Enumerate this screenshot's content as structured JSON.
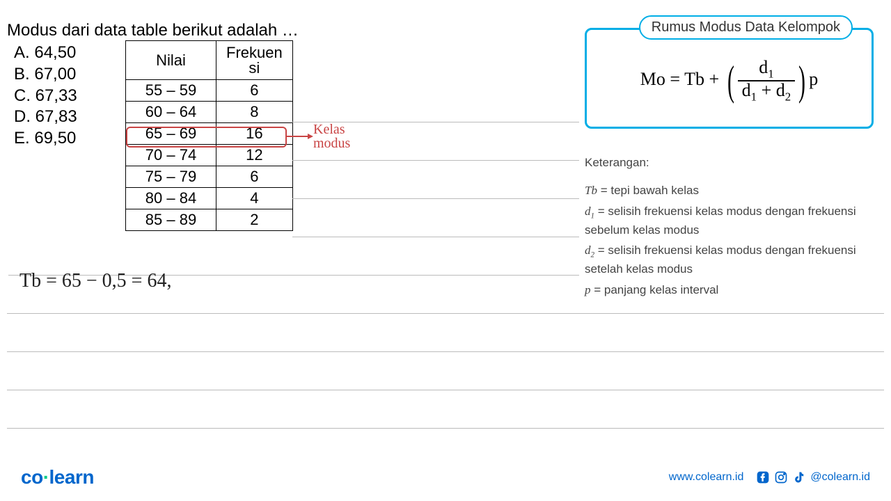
{
  "question": "Modus dari data table berikut adalah …",
  "answers": {
    "a": "A. 64,50",
    "b": "B. 67,00",
    "c": "C. 67,33",
    "d": "D. 67,83",
    "e": "E. 69,50"
  },
  "table": {
    "header_nilai": "Nilai",
    "header_frekuensi_line1": "Frekuen",
    "header_frekuensi_line2": "si",
    "rows": [
      {
        "nilai": "55 – 59",
        "freq": "6"
      },
      {
        "nilai": "60 – 64",
        "freq": "8"
      },
      {
        "nilai": "65 – 69",
        "freq": "16"
      },
      {
        "nilai": "70 – 74",
        "freq": "12"
      },
      {
        "nilai": "75 – 79",
        "freq": "6"
      },
      {
        "nilai": "80 – 84",
        "freq": "4"
      },
      {
        "nilai": "85 – 89",
        "freq": "2"
      }
    ]
  },
  "modal_annotation_line1": "Kelas",
  "modal_annotation_line2": "modus",
  "formula": {
    "title": "Rumus Modus Data Kelompok",
    "lhs": "Mo = Tb +",
    "numerator": "d",
    "numerator_sub": "1",
    "denom_part1": "d",
    "denom_sub1": "1",
    "denom_plus": "+ d",
    "denom_sub2": "2",
    "suffix": "p"
  },
  "keterangan": {
    "title": "Keterangan:",
    "tb": "Tb",
    "tb_desc": " = tepi bawah kelas",
    "d1": "d",
    "d1_sub": "1",
    "d1_desc": " = selisih frekuensi kelas modus dengan frekuensi sebelum kelas modus",
    "d2": "d",
    "d2_sub": "2",
    "d2_desc": " = selisih frekuensi kelas modus dengan frekuensi setelah kelas modus",
    "p": "p",
    "p_desc": " = panjang kelas interval"
  },
  "handwritten": "Tb = 65 − 0,5 = 64,",
  "footer": {
    "logo_part1": "co",
    "logo_dot": " ",
    "logo_part2": "learn",
    "website": "www.colearn.id",
    "handle": "@colearn.id"
  },
  "chart_data": {
    "type": "table",
    "title": "Modus dari data table berikut adalah …",
    "columns": [
      "Nilai",
      "Frekuensi"
    ],
    "rows": [
      [
        "55 – 59",
        6
      ],
      [
        "60 – 64",
        8
      ],
      [
        "65 – 69",
        16
      ],
      [
        "70 – 74",
        12
      ],
      [
        "75 – 79",
        6
      ],
      [
        "80 – 84",
        4
      ],
      [
        "85 – 89",
        2
      ]
    ],
    "answer_options": [
      "64,50",
      "67,00",
      "67,33",
      "67,83",
      "69,50"
    ],
    "modal_class": "65 – 69",
    "formula": "Mo = Tb + (d1 / (d1 + d2)) * p",
    "work": "Tb = 65 − 0,5 = 64,"
  }
}
